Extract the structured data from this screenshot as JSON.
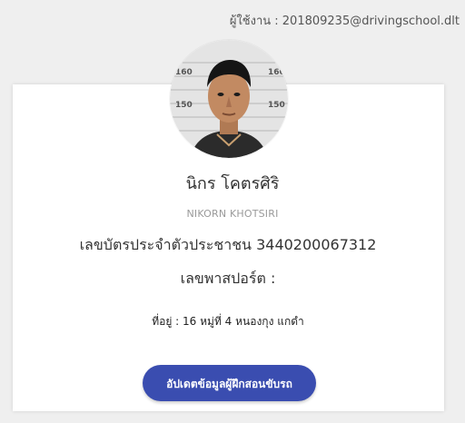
{
  "header": {
    "user_label": "ผู้ใช้งาน : 201809235@drivingschool.dlt"
  },
  "profile": {
    "photo_alt": "profile photo",
    "name_th": "นิกร โคตรศิริ",
    "name_en": "NIKORN KHOTSIRI",
    "id_card": "เลขบัตรประจำตัวประชาชน 3440200067312",
    "passport": "เลขพาสปอร์ต :",
    "address": "ที่อยู่ : 16 หมู่ที่ 4 หนองกุง แกดำ"
  },
  "actions": {
    "update_label": "อัปเดตข้อมูลผู้ฝึกสอนขับรถ"
  },
  "colors": {
    "button_bg": "#3a4db0",
    "page_bg": "#efefef"
  }
}
